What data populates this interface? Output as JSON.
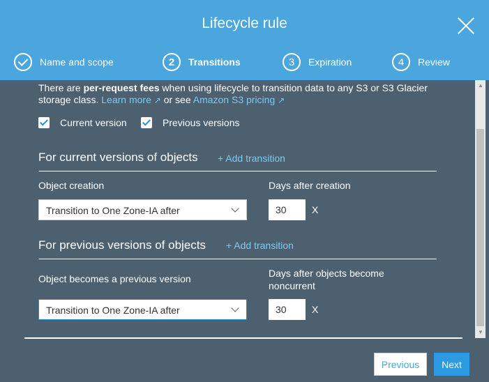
{
  "title": "Lifecycle rule",
  "steps": [
    {
      "num": "",
      "label": "Name and scope"
    },
    {
      "num": "2",
      "label": "Transitions"
    },
    {
      "num": "3",
      "label": "Expiration"
    },
    {
      "num": "4",
      "label": "Review"
    }
  ],
  "info": {
    "pre": "There are ",
    "bold": "per-request fees",
    "mid": " when using lifecycle to transition data to any S3 or S3 Glacier storage class. ",
    "learn": "Learn more",
    "or": " or see ",
    "pricing": "Amazon S3 pricing"
  },
  "checkboxes": {
    "current": "Current version",
    "previous": "Previous versions"
  },
  "current": {
    "heading": "For current versions of objects",
    "add": "+ Add transition",
    "left_label": "Object creation",
    "right_label": "Days after creation",
    "select": "Transition to One Zone-IA after",
    "days": "30",
    "x": "X"
  },
  "previous": {
    "heading": "For previous versions of objects",
    "add": "+ Add transition",
    "left_label": "Object becomes a previous version",
    "right_label": "Days after objects become noncurrent",
    "select": "Transition to One Zone-IA after",
    "days": "30",
    "x": "X"
  },
  "buttons": {
    "previous": "Previous",
    "next": "Next"
  }
}
